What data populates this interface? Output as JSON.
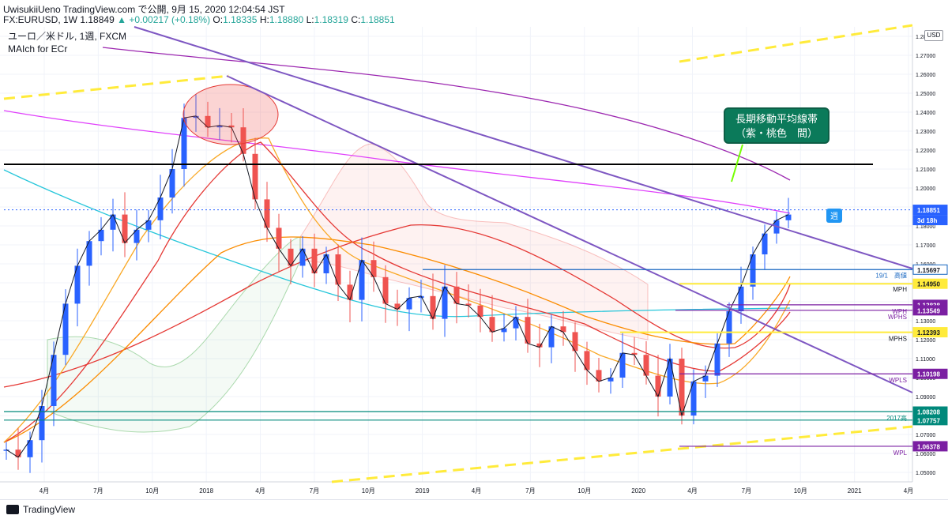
{
  "header": {
    "author": "UwisukiiUeno",
    "published": "TradingView.com で公開, 9月 15, 2020 12:04:54 JST",
    "symbol": "FX:EURUSD, 1W",
    "last": "1.18849",
    "change_icon": "up-triangle-icon",
    "change": "+0.00217 (+0.18%)",
    "ohlc": [
      {
        "k": "O:",
        "v": "1.18335"
      },
      {
        "k": "H:",
        "v": "1.18880"
      },
      {
        "k": "L:",
        "v": "1.18319"
      },
      {
        "k": "C:",
        "v": "1.18851"
      }
    ]
  },
  "legend": {
    "line1": "ユーロ／米ドル, 1週, FXCM",
    "line2": "MAIch for ECr"
  },
  "callout": {
    "line1": "長期移動平均線帯",
    "line2": "（紫・桃色　間）"
  },
  "currency_badge": "USD",
  "footer_brand": "TradingView",
  "colors": {
    "up": "#2962ff",
    "down": "#ef5350",
    "ma_purple": "#9c27b0",
    "ma_magenta": "#e040fb",
    "ma_teal": "#26c6da",
    "ma_red": "#e53935",
    "ma_orange": "#fb8c00",
    "trend": "#7e57c2",
    "level_yellow": "#ffeb3b",
    "level_teal": "#00897b",
    "level_blue": "#1565c0",
    "level_purple": "#7b1fa2"
  },
  "chart_data": {
    "type": "candlestick",
    "instrument": "EURUSD",
    "timeframe": "1W",
    "ylim": [
      1.045,
      1.285
    ],
    "x_ticks": [
      "4月",
      "7月",
      "10月",
      "2018",
      "4月",
      "7月",
      "10月",
      "2019",
      "4月",
      "7月",
      "10月",
      "2020",
      "4月",
      "7月",
      "10月",
      "2021",
      "4月"
    ],
    "y_ticks": [
      "1.05000",
      "1.06000",
      "1.07000",
      "1.08000",
      "1.09000",
      "1.10000",
      "1.11000",
      "1.12000",
      "1.13000",
      "1.14000",
      "1.15000",
      "1.16000",
      "1.17000",
      "1.18000",
      "1.19000",
      "1.20000",
      "1.21000",
      "1.22000",
      "1.23000",
      "1.24000",
      "1.25000",
      "1.26000",
      "1.27000",
      "1.28000"
    ],
    "close_path": [
      1.062,
      1.058,
      1.067,
      1.085,
      1.112,
      1.139,
      1.159,
      1.172,
      1.178,
      1.186,
      1.171,
      1.178,
      1.183,
      1.195,
      1.21,
      1.237,
      1.238,
      1.232,
      1.233,
      1.232,
      1.218,
      1.194,
      1.179,
      1.168,
      1.159,
      1.168,
      1.155,
      1.165,
      1.149,
      1.141,
      1.162,
      1.153,
      1.139,
      1.136,
      1.142,
      1.143,
      1.131,
      1.148,
      1.139,
      1.138,
      1.132,
      1.124,
      1.126,
      1.132,
      1.118,
      1.116,
      1.127,
      1.124,
      1.114,
      1.104,
      1.098,
      1.1,
      1.113,
      1.112,
      1.101,
      1.09,
      1.11,
      1.08,
      1.098,
      1.101,
      1.118,
      1.135,
      1.148,
      1.165,
      1.176,
      1.183,
      1.186
    ],
    "price_labels": [
      {
        "value": "1.18851",
        "text": "1.18851",
        "style": "blue"
      },
      {
        "value": "3d 18h",
        "text": "3d 18h",
        "style": "blue"
      },
      {
        "value": "1.15697",
        "text": "1.15697",
        "style": "blue-outline"
      },
      {
        "value": "1.14950",
        "text": "1.14950",
        "style": "yellow"
      },
      {
        "value": "1.13838",
        "text": "1.13838",
        "style": "purple"
      },
      {
        "value": "1.13549",
        "text": "1.13549",
        "style": "purple"
      },
      {
        "value": "1.12393",
        "text": "1.12393",
        "style": "yellow"
      },
      {
        "value": "1.10198",
        "text": "1.10198",
        "style": "purple"
      },
      {
        "value": "1.08208",
        "text": "1.08208",
        "style": "teal"
      },
      {
        "value": "1.07757",
        "text": "1.07757",
        "style": "teal"
      },
      {
        "value": "1.06378",
        "text": "1.06378",
        "style": "purple"
      }
    ],
    "level_annotations": [
      "19/1　高値",
      "MPH",
      "WPH",
      "WPHS",
      "MPHS",
      "WPLS",
      "2017高",
      "WPL"
    ],
    "marker": "週",
    "black_level": 1.2125,
    "levels": [
      {
        "price": 1.15697,
        "color": "#1565c0",
        "label": "19/1　高値"
      },
      {
        "price": 1.1495,
        "color": "#ffeb3b",
        "label": "MPH"
      },
      {
        "price": 1.13838,
        "color": "#7b1fa2",
        "label": "WPH"
      },
      {
        "price": 1.13549,
        "color": "#7b1fa2",
        "label": "WPHS"
      },
      {
        "price": 1.12393,
        "color": "#ffeb3b",
        "label": "MPHS"
      },
      {
        "price": 1.10198,
        "color": "#7b1fa2",
        "label": "WPLS"
      },
      {
        "price": 1.08208,
        "color": "#00897b",
        "label": "2017高"
      },
      {
        "price": 1.07757,
        "color": "#00897b",
        "label": ""
      },
      {
        "price": 1.06378,
        "color": "#7b1fa2",
        "label": "WPL"
      }
    ]
  }
}
